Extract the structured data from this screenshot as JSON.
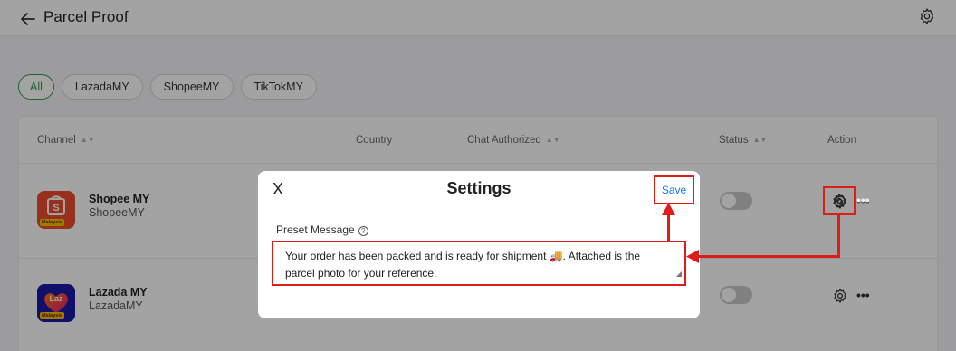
{
  "header": {
    "title": "Parcel Proof"
  },
  "filters": [
    "All",
    "LazadaMY",
    "ShopeeMY",
    "TikTokMY"
  ],
  "table": {
    "columns": {
      "channel": "Channel",
      "country": "Country",
      "chat_authorized": "Chat Authorized",
      "status": "Status",
      "action": "Action"
    },
    "rows": [
      {
        "name": "Shopee MY",
        "sub": "ShopeeMY",
        "logo_badge": "Malaysia",
        "logo_letter": "S"
      },
      {
        "name": "Lazada MY",
        "sub": "LazadaMY",
        "logo_badge": "Malaysia",
        "logo_letter": "Laz"
      }
    ],
    "more_glyph": "•••"
  },
  "modal": {
    "close_glyph": "X",
    "title": "Settings",
    "save_label": "Save",
    "field_label": "Preset Message",
    "help_glyph": "?",
    "message": "Your order has been packed and is ready for shipment 🚚. Attached is the parcel photo for your reference."
  },
  "colors": {
    "accent_green": "#2e9b4f",
    "link_blue": "#1677ff",
    "annotation_red": "#e01b1b",
    "shopee_orange": "#ee4d2d",
    "lazada_blue": "#1a1aa8"
  }
}
